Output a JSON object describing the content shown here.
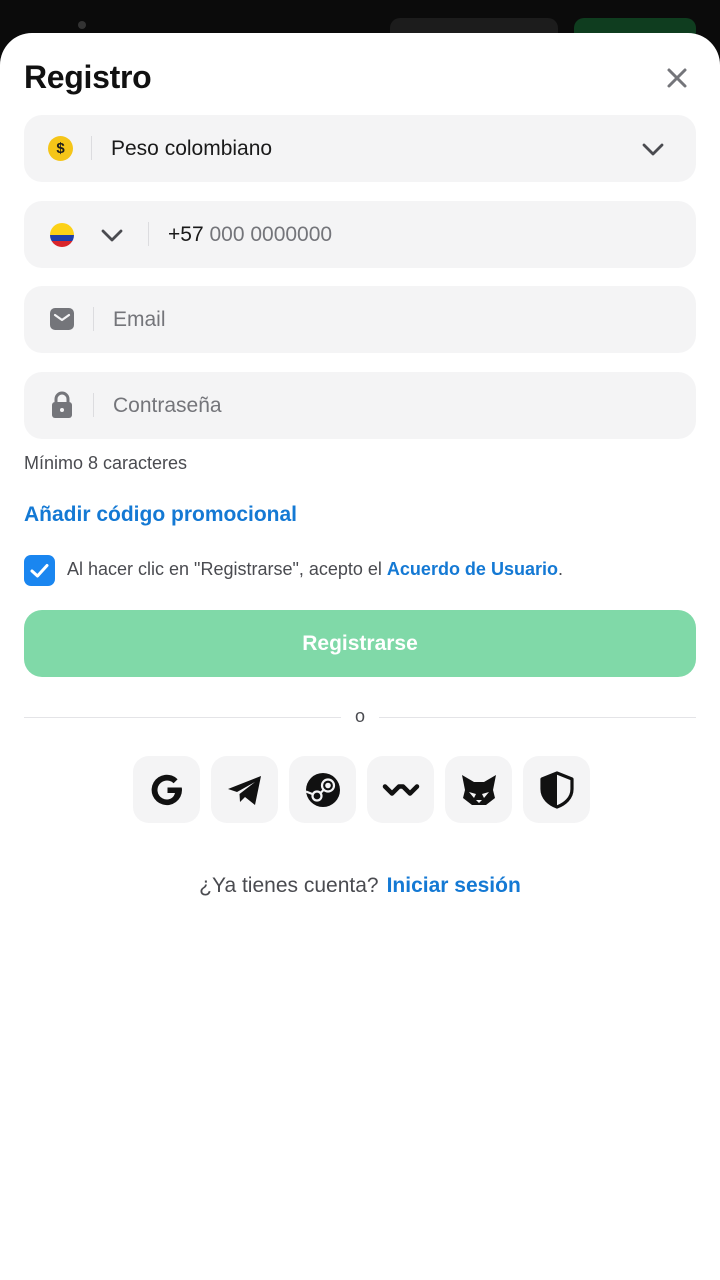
{
  "header": {
    "title": "Registro"
  },
  "currency": {
    "symbol": "$",
    "value": "Peso colombiano"
  },
  "phone": {
    "code": "+57",
    "placeholder": "000 0000000"
  },
  "email": {
    "placeholder": "Email"
  },
  "password": {
    "placeholder": "Contraseña",
    "hint": "Mínimo 8 caracteres"
  },
  "promo": {
    "label": "Añadir código promocional"
  },
  "agreement": {
    "checked": true,
    "text": "Al hacer clic en \"Registrarse\", acepto el ",
    "link": "Acuerdo de Usuario",
    "suffix": "."
  },
  "register_button": {
    "label": "Registrarse"
  },
  "divider": {
    "label": "o"
  },
  "social": [
    {
      "icon": "google-icon"
    },
    {
      "icon": "telegram-icon"
    },
    {
      "icon": "steam-icon"
    },
    {
      "icon": "walletconnect-icon"
    },
    {
      "icon": "metamask-icon"
    },
    {
      "icon": "shield-icon"
    }
  ],
  "footer": {
    "question": "¿Ya tienes cuenta?",
    "link": "Iniciar sesión"
  },
  "colors": {
    "accent": "#1479d4",
    "button": "#80d9a8",
    "field_bg": "#f4f4f5",
    "checkbox": "#1a86f0"
  }
}
